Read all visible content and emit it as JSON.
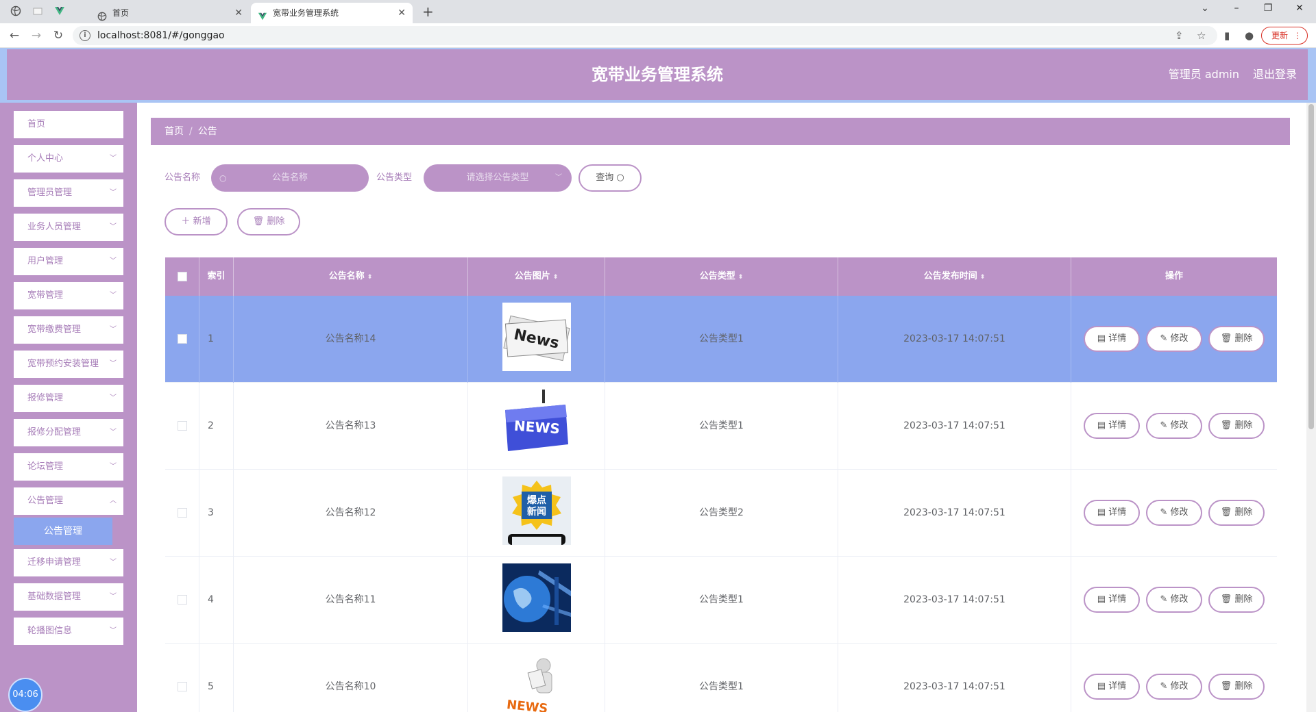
{
  "browser": {
    "tabs": [
      {
        "title": "首页"
      },
      {
        "title": "宽带业务管理系统"
      }
    ],
    "url": "localhost:8081/#/gonggao",
    "update_label": "更新"
  },
  "header": {
    "title": "宽带业务管理系统",
    "user": "管理员 admin",
    "logout": "退出登录"
  },
  "sidebar": {
    "items": [
      {
        "label": "首页",
        "has_children": false
      },
      {
        "label": "个人中心",
        "has_children": true
      },
      {
        "label": "管理员管理",
        "has_children": true
      },
      {
        "label": "业务人员管理",
        "has_children": true
      },
      {
        "label": "用户管理",
        "has_children": true
      },
      {
        "label": "宽带管理",
        "has_children": true
      },
      {
        "label": "宽带缴费管理",
        "has_children": true
      },
      {
        "label": "宽带预约安装管理",
        "has_children": true
      },
      {
        "label": "报修管理",
        "has_children": true
      },
      {
        "label": "报修分配管理",
        "has_children": true
      },
      {
        "label": "论坛管理",
        "has_children": true
      },
      {
        "label": "公告管理",
        "has_children": true
      },
      {
        "label": "迁移申请管理",
        "has_children": true
      },
      {
        "label": "基础数据管理",
        "has_children": true
      },
      {
        "label": "轮播图信息",
        "has_children": true
      }
    ],
    "active_sub": "公告管理",
    "clock": "04:06"
  },
  "breadcrumb": {
    "home": "首页",
    "current": "公告"
  },
  "search": {
    "name_label": "公告名称",
    "name_placeholder": "公告名称",
    "type_label": "公告类型",
    "type_placeholder": "请选择公告类型",
    "query_label": "查询"
  },
  "actions": {
    "add": "新增",
    "delete": "删除"
  },
  "table": {
    "headers": {
      "index": "索引",
      "name": "公告名称",
      "image": "公告图片",
      "type": "公告类型",
      "time": "公告发布时间",
      "ops": "操作"
    },
    "op_labels": {
      "detail": "详情",
      "edit": "修改",
      "delete": "删除"
    },
    "rows": [
      {
        "index": "1",
        "name": "公告名称14",
        "image": "news-newspaper",
        "type": "公告类型1",
        "time": "2023-03-17 14:07:51",
        "selected": true
      },
      {
        "index": "2",
        "name": "公告名称13",
        "image": "news-blue-key",
        "type": "公告类型1",
        "time": "2023-03-17 14:07:51",
        "selected": false
      },
      {
        "index": "3",
        "name": "公告名称12",
        "image": "breaking-news-badge",
        "type": "公告类型2",
        "time": "2023-03-17 14:07:51",
        "selected": false
      },
      {
        "index": "4",
        "name": "公告名称11",
        "image": "globe-news",
        "type": "公告类型1",
        "time": "2023-03-17 14:07:51",
        "selected": false
      },
      {
        "index": "5",
        "name": "公告名称10",
        "image": "news-figure",
        "type": "公告类型1",
        "time": "2023-03-17 14:07:51",
        "selected": false
      }
    ]
  },
  "image_labels": {
    "newspaper": "News",
    "key": "NEWS",
    "badge_line1": "爆点",
    "badge_line2": "新闻",
    "figure": "NEWS"
  },
  "colors": {
    "primary": "#bb93c7",
    "highlight": "#8ba6ee",
    "frame": "#a9c4f4"
  }
}
